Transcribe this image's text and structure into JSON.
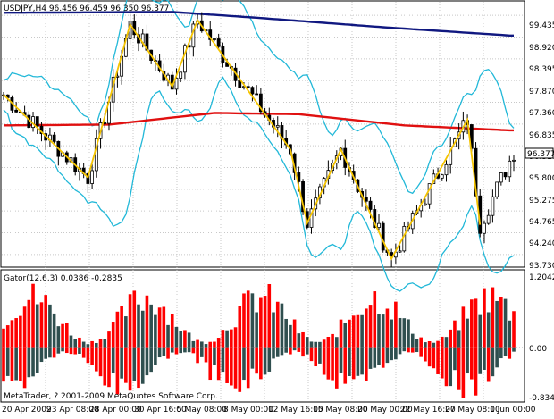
{
  "main": {
    "header": "USDJPY,H4  96.456 96.459 96.350 96.377",
    "price_tag": "96.377",
    "price_axis": [
      "99.435",
      "98.920",
      "98.395",
      "97.870",
      "97.360",
      "96.835",
      "96.310",
      "95.800",
      "95.275",
      "94.765",
      "94.240",
      "93.730"
    ]
  },
  "gator": {
    "header": "Gator(12,6,3) 0.0386 -0.2835",
    "axis": [
      "1.2042",
      "0.00",
      "-0.8342"
    ]
  },
  "footer": {
    "copyright": "MetaTrader, ? 2001-2009 MetaQuotes Software Corp."
  },
  "time_axis": [
    "20 Apr 2009",
    "23 Apr 08:00",
    "28 Apr 00:00",
    "30 Apr 16:00",
    "5 May 08:00",
    "8 May 00:00",
    "12 May 16:00",
    "15 May 08:00",
    "20 May 00:00",
    "22 May 16:00",
    "27 May 08:00",
    "1 Jun 00:00"
  ],
  "colors": {
    "background": "#ffffff",
    "grid": "#c8c8c8",
    "candles": "#000000",
    "bollinger": "#22b8d8",
    "zigzag": "#f5c400",
    "ma_long": "#e01010",
    "ma_longest": "#101880",
    "gator_up": "#ff0000",
    "gator_down": "#2f4f4f"
  },
  "chart_data": [
    {
      "type": "candlestick",
      "symbol": "USDJPY",
      "timeframe": "H4",
      "ylim": [
        93.6,
        99.9
      ],
      "zigzag": [
        {
          "i": 0,
          "p": 97.72
        },
        {
          "i": 20,
          "p": 95.72
        },
        {
          "i": 30,
          "p": 99.42
        },
        {
          "i": 40,
          "p": 97.92
        },
        {
          "i": 46,
          "p": 99.52
        },
        {
          "i": 68,
          "p": 96.4
        },
        {
          "i": 72,
          "p": 94.62
        },
        {
          "i": 80,
          "p": 96.4
        },
        {
          "i": 88,
          "p": 94.62
        },
        {
          "i": 92,
          "p": 93.76
        },
        {
          "i": 110,
          "p": 97.12
        },
        {
          "i": 113,
          "p": 94.58
        }
      ],
      "ma_red": [
        {
          "i": 0,
          "p": 96.98
        },
        {
          "i": 25,
          "p": 97.0
        },
        {
          "i": 50,
          "p": 97.28
        },
        {
          "i": 70,
          "p": 97.25
        },
        {
          "i": 95,
          "p": 96.98
        },
        {
          "i": 120,
          "p": 96.86
        }
      ],
      "ma_blue": [
        {
          "i": 0,
          "p": 99.7
        },
        {
          "i": 40,
          "p": 99.72
        },
        {
          "i": 60,
          "p": 99.58
        },
        {
          "i": 90,
          "p": 99.35
        },
        {
          "i": 120,
          "p": 99.15
        }
      ]
    },
    {
      "type": "histogram",
      "name": "Gator(12,6,3)",
      "ylim": [
        -0.8342,
        1.2042
      ]
    }
  ]
}
